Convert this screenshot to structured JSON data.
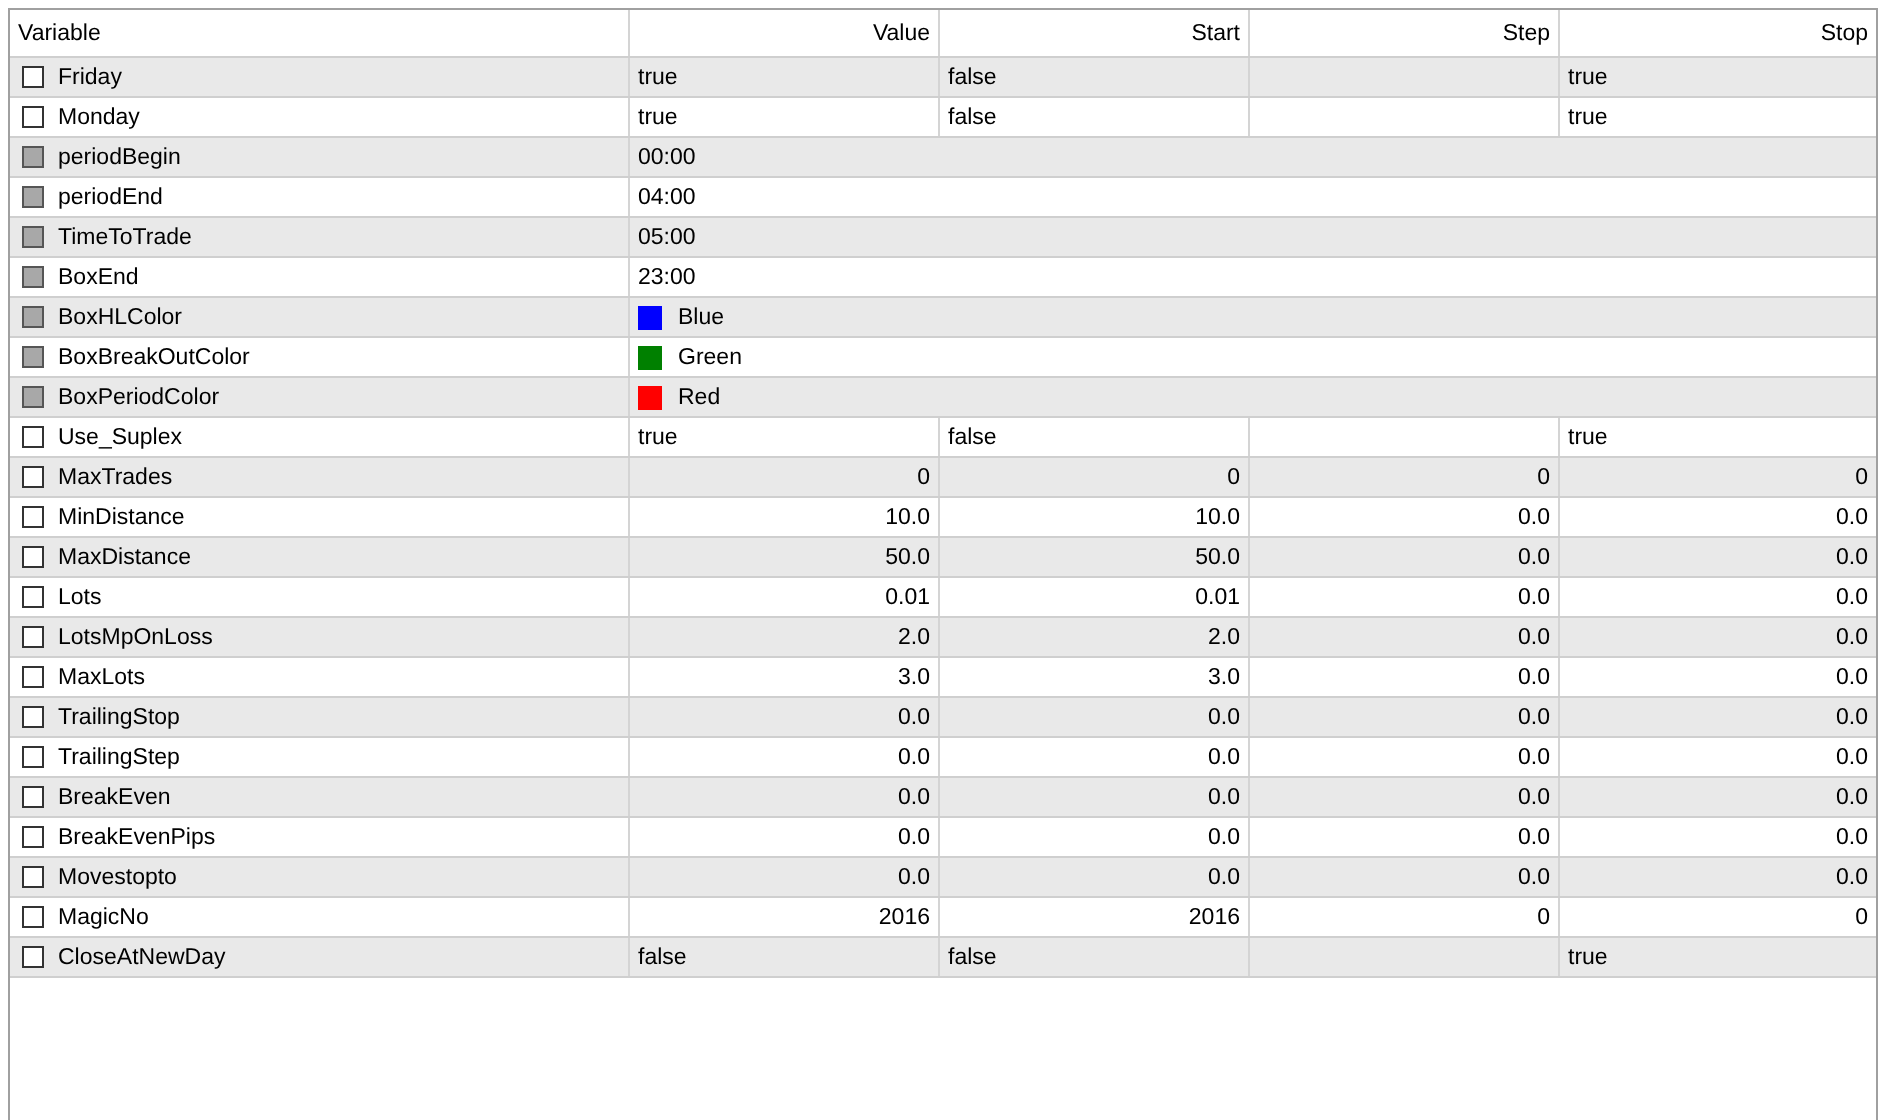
{
  "table": {
    "columns": [
      "Variable",
      "Value",
      "Start",
      "Step",
      "Stop"
    ],
    "rows": [
      {
        "kind": "bool",
        "name": "Friday",
        "checked": false,
        "disabled": false,
        "value": "true",
        "start": "false",
        "stop": "true"
      },
      {
        "kind": "bool",
        "name": "Monday",
        "checked": false,
        "disabled": false,
        "value": "true",
        "start": "false",
        "stop": "true"
      },
      {
        "kind": "time",
        "name": "periodBegin",
        "checked": false,
        "disabled": true,
        "value": "00:00"
      },
      {
        "kind": "time",
        "name": "periodEnd",
        "checked": false,
        "disabled": true,
        "value": "04:00"
      },
      {
        "kind": "time",
        "name": "TimeToTrade",
        "checked": false,
        "disabled": true,
        "value": "05:00"
      },
      {
        "kind": "time",
        "name": "BoxEnd",
        "checked": false,
        "disabled": true,
        "value": "23:00"
      },
      {
        "kind": "color",
        "name": "BoxHLColor",
        "checked": false,
        "disabled": true,
        "value": "Blue",
        "color": "#0000ff"
      },
      {
        "kind": "color",
        "name": "BoxBreakOutColor",
        "checked": false,
        "disabled": true,
        "value": "Green",
        "color": "#008000"
      },
      {
        "kind": "color",
        "name": "BoxPeriodColor",
        "checked": false,
        "disabled": true,
        "value": "Red",
        "color": "#ff0000"
      },
      {
        "kind": "bool",
        "name": "Use_Suplex",
        "checked": false,
        "disabled": false,
        "value": "true",
        "start": "false",
        "stop": "true"
      },
      {
        "kind": "number",
        "name": "MaxTrades",
        "checked": false,
        "disabled": false,
        "value": "0",
        "start": "0",
        "step": "0",
        "stop": "0"
      },
      {
        "kind": "number",
        "name": "MinDistance",
        "checked": false,
        "disabled": false,
        "value": "10.0",
        "start": "10.0",
        "step": "0.0",
        "stop": "0.0"
      },
      {
        "kind": "number",
        "name": "MaxDistance",
        "checked": false,
        "disabled": false,
        "value": "50.0",
        "start": "50.0",
        "step": "0.0",
        "stop": "0.0"
      },
      {
        "kind": "number",
        "name": "Lots",
        "checked": false,
        "disabled": false,
        "value": "0.01",
        "start": "0.01",
        "step": "0.0",
        "stop": "0.0"
      },
      {
        "kind": "number",
        "name": "LotsMpOnLoss",
        "checked": false,
        "disabled": false,
        "value": "2.0",
        "start": "2.0",
        "step": "0.0",
        "stop": "0.0"
      },
      {
        "kind": "number",
        "name": "MaxLots",
        "checked": false,
        "disabled": false,
        "value": "3.0",
        "start": "3.0",
        "step": "0.0",
        "stop": "0.0"
      },
      {
        "kind": "number",
        "name": "TrailingStop",
        "checked": false,
        "disabled": false,
        "value": "0.0",
        "start": "0.0",
        "step": "0.0",
        "stop": "0.0"
      },
      {
        "kind": "number",
        "name": "TrailingStep",
        "checked": false,
        "disabled": false,
        "value": "0.0",
        "start": "0.0",
        "step": "0.0",
        "stop": "0.0"
      },
      {
        "kind": "number",
        "name": "BreakEven",
        "checked": false,
        "disabled": false,
        "value": "0.0",
        "start": "0.0",
        "step": "0.0",
        "stop": "0.0"
      },
      {
        "kind": "number",
        "name": "BreakEvenPips",
        "checked": false,
        "disabled": false,
        "value": "0.0",
        "start": "0.0",
        "step": "0.0",
        "stop": "0.0"
      },
      {
        "kind": "number",
        "name": "Movestopto",
        "checked": false,
        "disabled": false,
        "value": "0.0",
        "start": "0.0",
        "step": "0.0",
        "stop": "0.0"
      },
      {
        "kind": "number",
        "name": "MagicNo",
        "checked": false,
        "disabled": false,
        "value": "2016",
        "start": "2016",
        "step": "0",
        "stop": "0"
      },
      {
        "kind": "bool",
        "name": "CloseAtNewDay",
        "checked": false,
        "disabled": false,
        "value": "false",
        "start": "false",
        "stop": "true"
      }
    ]
  }
}
